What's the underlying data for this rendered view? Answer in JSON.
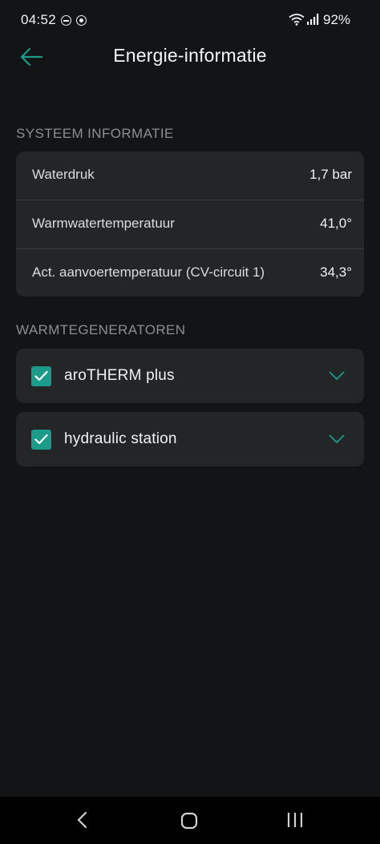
{
  "status_bar": {
    "time": "04:52",
    "battery": "92%"
  },
  "header": {
    "title": "Energie-informatie"
  },
  "system_info": {
    "section_title": "SYSTEEM INFORMATIE",
    "rows": [
      {
        "label": "Waterdruk",
        "value": "1,7 bar"
      },
      {
        "label": "Warmwatertemperatuur",
        "value": "41,0°"
      },
      {
        "label": "Act. aanvoertemperatuur (CV-circuit 1)",
        "value": "34,3°"
      }
    ]
  },
  "heat_generators": {
    "section_title": "WARMTEGENERATOREN",
    "items": [
      {
        "label": "aroTHERM plus",
        "checked": true
      },
      {
        "label": "hydraulic station",
        "checked": true
      }
    ]
  },
  "colors": {
    "background": "#131416",
    "card": "#232527",
    "accent": "#1b9c8b",
    "section_title": "#8c8e90",
    "divider": "#3a3c3f"
  },
  "icons": {
    "back": "arrow-left-icon",
    "checkbox": "checkbox-checked-icon",
    "expand": "chevron-down-icon",
    "nav_back": "nav-back-icon",
    "nav_home": "nav-home-icon",
    "nav_recents": "nav-recents-icon"
  }
}
